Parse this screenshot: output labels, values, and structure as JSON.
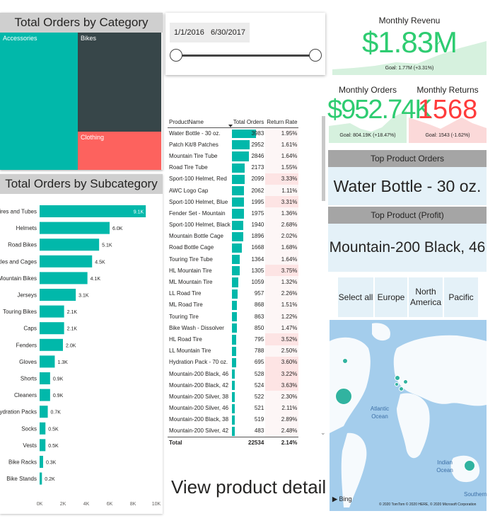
{
  "treemap": {
    "title": "Total Orders by Category",
    "segments": [
      {
        "label": "Accessories",
        "color": "#01b8aa"
      },
      {
        "label": "Bikes",
        "color": "#374649"
      },
      {
        "label": "Clothing",
        "color": "#fd625e"
      }
    ]
  },
  "subcategory_chart": {
    "title": "Total Orders by Subcategory"
  },
  "chart_data": [
    {
      "type": "bar",
      "title": "Total Orders by Subcategory",
      "orientation": "horizontal",
      "categories": [
        "Tires and Tubes",
        "Helmets",
        "Road Bikes",
        "Bottles and Cages",
        "Mountain Bikes",
        "Jerseys",
        "Touring Bikes",
        "Caps",
        "Fenders",
        "Gloves",
        "Shorts",
        "Cleaners",
        "Hydration Packs",
        "Socks",
        "Vests",
        "Bike Racks",
        "Bike Stands"
      ],
      "values": [
        9100,
        6000,
        5100,
        4500,
        4100,
        3100,
        2100,
        2100,
        2000,
        1300,
        900,
        900,
        700,
        500,
        500,
        300,
        200
      ],
      "data_labels": [
        "9.1K",
        "6.0K",
        "5.1K",
        "4.5K",
        "4.1K",
        "3.1K",
        "2.1K",
        "2.1K",
        "2.0K",
        "1.3K",
        "0.9K",
        "0.9K",
        "0.7K",
        "0.5K",
        "0.5K",
        "0.3K",
        "0.2K"
      ],
      "xticks": [
        "0K",
        "2K",
        "4K",
        "6K",
        "8K",
        "10K"
      ],
      "xlim": [
        0,
        10000
      ],
      "color": "#01b8aa"
    }
  ],
  "date_slicer": {
    "start": "1/1/2016",
    "end": "6/30/2017"
  },
  "product_table": {
    "headers": [
      "ProductName",
      "Total Orders",
      "Return Rate"
    ],
    "max_orders": 3983,
    "rows": [
      {
        "name": "Water Bottle - 30 oz.",
        "orders": "3983",
        "rate": "1.95%",
        "high": false
      },
      {
        "name": "Patch Kit/8 Patches",
        "orders": "2952",
        "rate": "1.61%",
        "high": false
      },
      {
        "name": "Mountain Tire Tube",
        "orders": "2846",
        "rate": "1.64%",
        "high": false
      },
      {
        "name": "Road Tire Tube",
        "orders": "2173",
        "rate": "1.55%",
        "high": false
      },
      {
        "name": "Sport-100 Helmet, Red",
        "orders": "2099",
        "rate": "3.33%",
        "high": true
      },
      {
        "name": "AWC Logo Cap",
        "orders": "2062",
        "rate": "1.11%",
        "high": false
      },
      {
        "name": "Sport-100 Helmet, Blue",
        "orders": "1995",
        "rate": "3.31%",
        "high": true
      },
      {
        "name": "Fender Set - Mountain",
        "orders": "1975",
        "rate": "1.36%",
        "high": false
      },
      {
        "name": "Sport-100 Helmet, Black",
        "orders": "1940",
        "rate": "2.68%",
        "high": false
      },
      {
        "name": "Mountain Bottle Cage",
        "orders": "1896",
        "rate": "2.02%",
        "high": false
      },
      {
        "name": "Road Bottle Cage",
        "orders": "1668",
        "rate": "1.68%",
        "high": false
      },
      {
        "name": "Touring Tire Tube",
        "orders": "1364",
        "rate": "1.64%",
        "high": false
      },
      {
        "name": "HL Mountain Tire",
        "orders": "1305",
        "rate": "3.75%",
        "high": true
      },
      {
        "name": "ML Mountain Tire",
        "orders": "1059",
        "rate": "1.32%",
        "high": false
      },
      {
        "name": "LL Road Tire",
        "orders": "957",
        "rate": "2.26%",
        "high": false
      },
      {
        "name": "ML Road Tire",
        "orders": "868",
        "rate": "1.51%",
        "high": false
      },
      {
        "name": "Touring Tire",
        "orders": "863",
        "rate": "1.22%",
        "high": false
      },
      {
        "name": "Bike Wash - Dissolver",
        "orders": "850",
        "rate": "1.47%",
        "high": false
      },
      {
        "name": "HL Road Tire",
        "orders": "795",
        "rate": "3.52%",
        "high": true
      },
      {
        "name": "LL Mountain Tire",
        "orders": "788",
        "rate": "2.50%",
        "high": false
      },
      {
        "name": "Hydration Pack - 70 oz.",
        "orders": "695",
        "rate": "3.60%",
        "high": true
      },
      {
        "name": "Mountain-200 Black, 46",
        "orders": "528",
        "rate": "3.22%",
        "high": true
      },
      {
        "name": "Mountain-200 Black, 42",
        "orders": "524",
        "rate": "3.63%",
        "high": true
      },
      {
        "name": "Mountain-200 Silver, 38",
        "orders": "522",
        "rate": "2.30%",
        "high": false
      },
      {
        "name": "Mountain-200 Silver, 46",
        "orders": "521",
        "rate": "2.11%",
        "high": false
      },
      {
        "name": "Mountain-200 Black, 38",
        "orders": "519",
        "rate": "2.89%",
        "high": false
      },
      {
        "name": "Mountain-200 Silver, 42",
        "orders": "483",
        "rate": "2.48%",
        "high": false
      }
    ],
    "total": {
      "label": "Total",
      "orders": "22534",
      "rate": "2.14%"
    }
  },
  "view_detail": {
    "label": "View product detail",
    "icon": "info-icon"
  },
  "kpis": {
    "revenue": {
      "title": "Monthly Revenu",
      "value": "$1.83M",
      "goal": "Goal: 1.77M (+3.31%)",
      "color": "#2ecc71"
    },
    "orders": {
      "title": "Monthly Orders",
      "value": "$952.74K",
      "goal": "Goal: 804.19K (+18.47%)",
      "color": "#2ecc71"
    },
    "returns": {
      "title": "Monthly Returns",
      "value": "1568",
      "goal": "Goal: 1543 (-1.62%)",
      "color": "#ff3b3b"
    }
  },
  "top_product": {
    "orders_title": "Top Product Orders",
    "orders_value": "Water Bottle - 30 oz.",
    "profit_title": "Top Product (Profit)",
    "profit_value": "Mountain-200 Black, 46"
  },
  "region_slicer": {
    "options": [
      "Select all",
      "Europe",
      "North America",
      "Pacific"
    ]
  },
  "map": {
    "labels": [
      "Atlantic Ocean",
      "Indian Ocean",
      "Southern"
    ],
    "bing_label": "Bing",
    "copyright": "© 2020 TomTom © 2020 HERE, © 2020 Microsoft Corporation"
  }
}
